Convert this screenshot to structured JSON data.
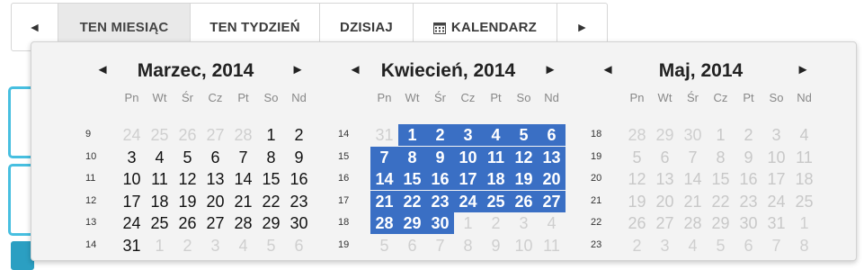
{
  "nav": {
    "prev": "◄",
    "this_month": "TEN MIESIĄC",
    "this_week": "TEN TYDZIEŃ",
    "today": "DZISIAJ",
    "calendar": "KALENDARZ",
    "next": "►"
  },
  "colors": {
    "selection": "#3a6fc4",
    "accent": "#47bfe0"
  },
  "day_headers": [
    "Pn",
    "Wt",
    "Śr",
    "Cz",
    "Pt",
    "So",
    "Nd"
  ],
  "months": [
    {
      "title": "Marzec, 2014",
      "prev": "◄",
      "next": "►",
      "weeks": [
        {
          "n": "9",
          "days": [
            [
              "24",
              "o"
            ],
            [
              "25",
              "o"
            ],
            [
              "26",
              "o"
            ],
            [
              "27",
              "o"
            ],
            [
              "28",
              "o"
            ],
            [
              "1",
              "c"
            ],
            [
              "2",
              "c"
            ]
          ]
        },
        {
          "n": "10",
          "days": [
            [
              "3",
              "c"
            ],
            [
              "4",
              "c"
            ],
            [
              "5",
              "c"
            ],
            [
              "6",
              "c"
            ],
            [
              "7",
              "c"
            ],
            [
              "8",
              "c"
            ],
            [
              "9",
              "c"
            ]
          ]
        },
        {
          "n": "11",
          "days": [
            [
              "10",
              "c"
            ],
            [
              "11",
              "c"
            ],
            [
              "12",
              "c"
            ],
            [
              "13",
              "c"
            ],
            [
              "14",
              "c"
            ],
            [
              "15",
              "c"
            ],
            [
              "16",
              "c"
            ]
          ]
        },
        {
          "n": "12",
          "days": [
            [
              "17",
              "c"
            ],
            [
              "18",
              "c"
            ],
            [
              "19",
              "c"
            ],
            [
              "20",
              "c"
            ],
            [
              "21",
              "c"
            ],
            [
              "22",
              "c"
            ],
            [
              "23",
              "c"
            ]
          ]
        },
        {
          "n": "13",
          "days": [
            [
              "24",
              "c"
            ],
            [
              "25",
              "c"
            ],
            [
              "26",
              "c"
            ],
            [
              "27",
              "c"
            ],
            [
              "28",
              "c"
            ],
            [
              "29",
              "c"
            ],
            [
              "30",
              "c"
            ]
          ]
        },
        {
          "n": "14",
          "days": [
            [
              "31",
              "c"
            ],
            [
              "1",
              "o"
            ],
            [
              "2",
              "o"
            ],
            [
              "3",
              "o"
            ],
            [
              "4",
              "o"
            ],
            [
              "5",
              "o"
            ],
            [
              "6",
              "o"
            ]
          ]
        }
      ]
    },
    {
      "title": "Kwiecień, 2014",
      "prev": "◄",
      "next": "►",
      "weeks": [
        {
          "n": "14",
          "days": [
            [
              "31",
              "o"
            ],
            [
              "1",
              "s"
            ],
            [
              "2",
              "s"
            ],
            [
              "3",
              "s"
            ],
            [
              "4",
              "s"
            ],
            [
              "5",
              "s"
            ],
            [
              "6",
              "s"
            ]
          ]
        },
        {
          "n": "15",
          "days": [
            [
              "7",
              "s"
            ],
            [
              "8",
              "s"
            ],
            [
              "9",
              "s"
            ],
            [
              "10",
              "s"
            ],
            [
              "11",
              "s"
            ],
            [
              "12",
              "s"
            ],
            [
              "13",
              "s"
            ]
          ]
        },
        {
          "n": "16",
          "days": [
            [
              "14",
              "s"
            ],
            [
              "15",
              "s"
            ],
            [
              "16",
              "s"
            ],
            [
              "17",
              "s"
            ],
            [
              "18",
              "s"
            ],
            [
              "19",
              "s"
            ],
            [
              "20",
              "s"
            ]
          ]
        },
        {
          "n": "17",
          "days": [
            [
              "21",
              "s"
            ],
            [
              "22",
              "s"
            ],
            [
              "23",
              "s"
            ],
            [
              "24",
              "s"
            ],
            [
              "25",
              "s"
            ],
            [
              "26",
              "s"
            ],
            [
              "27",
              "s"
            ]
          ]
        },
        {
          "n": "18",
          "days": [
            [
              "28",
              "s"
            ],
            [
              "29",
              "s"
            ],
            [
              "30",
              "s"
            ],
            [
              "1",
              "o"
            ],
            [
              "2",
              "o"
            ],
            [
              "3",
              "o"
            ],
            [
              "4",
              "o"
            ]
          ]
        },
        {
          "n": "19",
          "days": [
            [
              "5",
              "o"
            ],
            [
              "6",
              "o"
            ],
            [
              "7",
              "o"
            ],
            [
              "8",
              "o"
            ],
            [
              "9",
              "o"
            ],
            [
              "10",
              "o"
            ],
            [
              "11",
              "o"
            ]
          ]
        }
      ]
    },
    {
      "title": "Maj, 2014",
      "prev": "◄",
      "next": "►",
      "weeks": [
        {
          "n": "18",
          "days": [
            [
              "28",
              "o"
            ],
            [
              "29",
              "o"
            ],
            [
              "30",
              "o"
            ],
            [
              "1",
              "m"
            ],
            [
              "2",
              "m"
            ],
            [
              "3",
              "m"
            ],
            [
              "4",
              "m"
            ]
          ]
        },
        {
          "n": "19",
          "days": [
            [
              "5",
              "m"
            ],
            [
              "6",
              "m"
            ],
            [
              "7",
              "m"
            ],
            [
              "8",
              "m"
            ],
            [
              "9",
              "m"
            ],
            [
              "10",
              "m"
            ],
            [
              "11",
              "m"
            ]
          ]
        },
        {
          "n": "20",
          "days": [
            [
              "12",
              "m"
            ],
            [
              "13",
              "m"
            ],
            [
              "14",
              "m"
            ],
            [
              "15",
              "m"
            ],
            [
              "16",
              "m"
            ],
            [
              "17",
              "m"
            ],
            [
              "18",
              "m"
            ]
          ]
        },
        {
          "n": "21",
          "days": [
            [
              "19",
              "m"
            ],
            [
              "20",
              "m"
            ],
            [
              "21",
              "m"
            ],
            [
              "22",
              "m"
            ],
            [
              "23",
              "m"
            ],
            [
              "24",
              "m"
            ],
            [
              "25",
              "m"
            ]
          ]
        },
        {
          "n": "22",
          "days": [
            [
              "26",
              "m"
            ],
            [
              "27",
              "m"
            ],
            [
              "28",
              "m"
            ],
            [
              "29",
              "m"
            ],
            [
              "30",
              "m"
            ],
            [
              "31",
              "m"
            ],
            [
              "1",
              "o"
            ]
          ]
        },
        {
          "n": "23",
          "days": [
            [
              "2",
              "o"
            ],
            [
              "3",
              "o"
            ],
            [
              "4",
              "o"
            ],
            [
              "5",
              "o"
            ],
            [
              "6",
              "o"
            ],
            [
              "7",
              "o"
            ],
            [
              "8",
              "o"
            ]
          ]
        }
      ]
    }
  ]
}
